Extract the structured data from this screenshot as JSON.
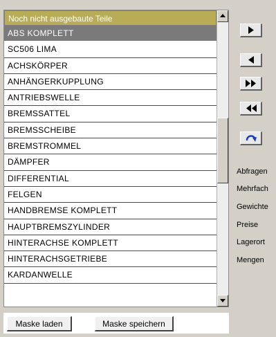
{
  "list": {
    "header": "Noch nicht ausgebaute Teile",
    "items": [
      "ABS KOMPLETT",
      "SC506 LIMA",
      "ACHSKÖRPER",
      "ANHÄNGERKUPPLUNG",
      "ANTRIEBSWELLE",
      "BREMSSATTEL",
      "BREMSSCHEIBE",
      "BREMSTROMMEL",
      "DÄMPFER",
      "DIFFERENTIAL",
      "FELGEN",
      "HANDBREMSE KOMPLETT",
      "HAUPTBREMSZYLINDER",
      "HINTERACHSE KOMPLETT",
      "HINTERACHSGETRIEBE",
      "KARDANWELLE"
    ],
    "selected_item": "ABS KOMPLETT"
  },
  "buttons": {
    "load_mask": "Maske laden",
    "save_mask": "Maske speichern"
  },
  "side_labels": [
    "Abfragen",
    "Mehrfach",
    "Gewichte",
    "Preise",
    "Lagerort",
    "Mengen"
  ],
  "icons": {
    "nav": [
      "move-right-icon",
      "move-left-icon",
      "move-all-right-icon",
      "move-all-left-icon",
      "refresh-icon"
    ]
  },
  "colors": {
    "header_bg": "#b8ac56",
    "selected_bg": "#7a7a7a",
    "refresh_blue": "#1a3fbf"
  }
}
